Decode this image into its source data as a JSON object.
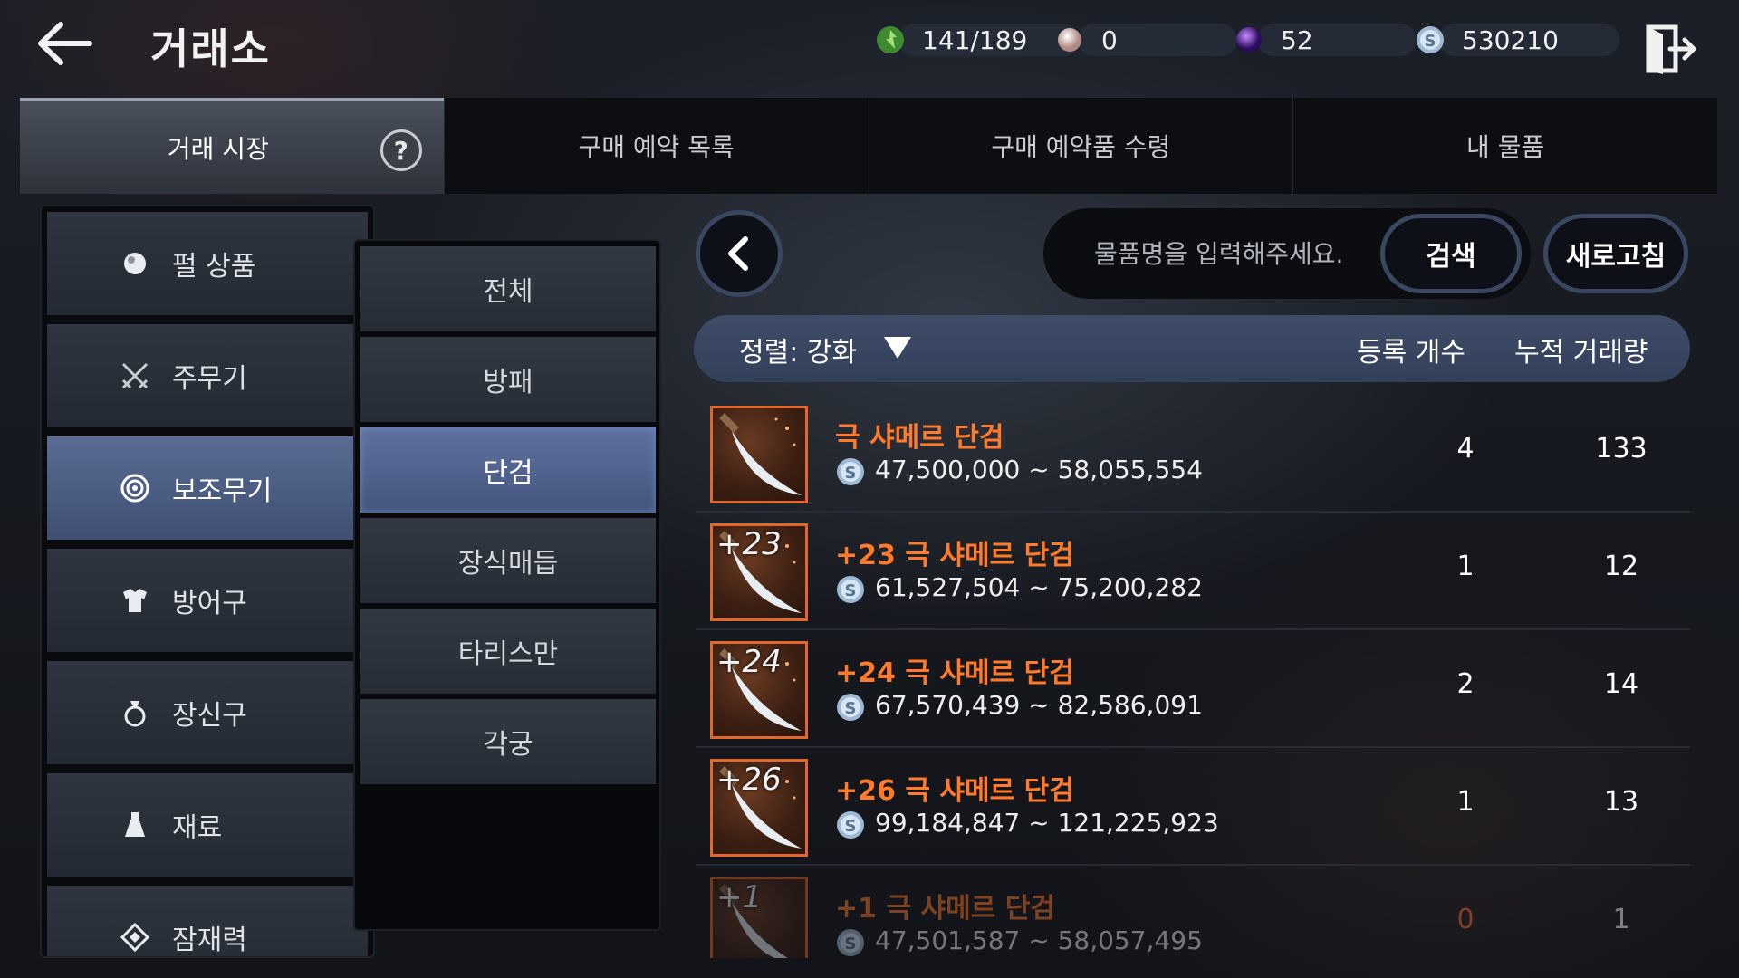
{
  "header": {
    "title": "거래소",
    "currencies": [
      {
        "icon": "energy-icon",
        "value": "141/189",
        "color": "#5fbf4a"
      },
      {
        "icon": "pearl-icon",
        "value": "0",
        "color": "#d9b9b0"
      },
      {
        "icon": "black-crystal-icon",
        "value": "52",
        "color": "#7a3ad0"
      },
      {
        "icon": "silver-icon",
        "value": "530210",
        "color": "#b8d0e8"
      }
    ]
  },
  "tabs": [
    {
      "label": "거래 시장",
      "active": true
    },
    {
      "label": "구매 예약 목록",
      "active": false
    },
    {
      "label": "구매 예약품 수령",
      "active": false
    },
    {
      "label": "내 물품",
      "active": false
    }
  ],
  "categories": [
    {
      "label": "펄 상품",
      "icon": "pearl-icon"
    },
    {
      "label": "주무기",
      "icon": "crossed-swords-icon"
    },
    {
      "label": "보조무기",
      "icon": "target-icon",
      "active": true
    },
    {
      "label": "방어구",
      "icon": "armor-icon"
    },
    {
      "label": "장신구",
      "icon": "ring-icon"
    },
    {
      "label": "재료",
      "icon": "flask-icon"
    },
    {
      "label": "잠재력",
      "icon": "diamond-icon"
    }
  ],
  "subcategories": [
    {
      "label": "전체"
    },
    {
      "label": "방패"
    },
    {
      "label": "단검",
      "active": true
    },
    {
      "label": "장식매듭"
    },
    {
      "label": "타리스만"
    },
    {
      "label": "각궁"
    }
  ],
  "search": {
    "placeholder": "물품명을 입력해주세요.",
    "button": "검색",
    "refresh": "새로고침"
  },
  "list_header": {
    "sort": "정렬: 강화",
    "count": "등록 개수",
    "volume": "누적 거래량"
  },
  "items": [
    {
      "level": "",
      "name": "극 샤메르 단검",
      "price": "47,500,000 ~ 58,055,554",
      "count": "4",
      "volume": "133"
    },
    {
      "level": "+23",
      "name": "+23 극 샤메르 단검",
      "price": "61,527,504 ~ 75,200,282",
      "count": "1",
      "volume": "12"
    },
    {
      "level": "+24",
      "name": "+24 극 샤메르 단검",
      "price": "67,570,439 ~ 82,586,091",
      "count": "2",
      "volume": "14"
    },
    {
      "level": "+26",
      "name": "+26 극 샤메르 단검",
      "price": "99,184,847 ~ 121,225,923",
      "count": "1",
      "volume": "13"
    },
    {
      "level": "+1",
      "name": "+1 극 샤메르 단검",
      "price": "47,501,587 ~ 58,057,495",
      "count": "0",
      "volume": "1"
    }
  ]
}
